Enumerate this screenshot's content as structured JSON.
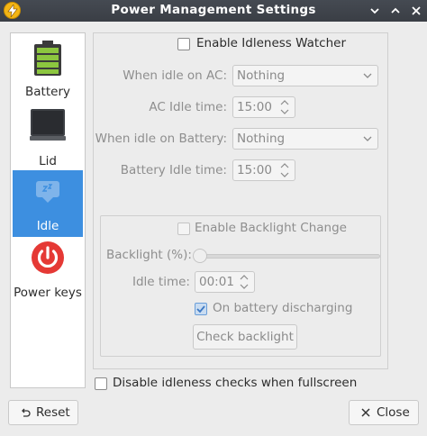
{
  "window": {
    "title": "Power Management Settings"
  },
  "sidebar": {
    "items": [
      {
        "label": "Battery",
        "icon": "battery-icon"
      },
      {
        "label": "Lid",
        "icon": "laptop-lid-icon"
      },
      {
        "label": "Idle",
        "icon": "idle-icon",
        "selected": true
      },
      {
        "label": "Power keys",
        "icon": "power-icon"
      }
    ]
  },
  "idle": {
    "enable_watcher_label": "Enable Idleness Watcher",
    "enable_watcher_checked": false,
    "ac": {
      "when_idle_label": "When idle on AC:",
      "when_idle_value": "Nothing",
      "idle_time_label": "AC Idle time:",
      "idle_time_value": "15:00"
    },
    "battery": {
      "when_idle_label": "When idle on Battery:",
      "when_idle_value": "Nothing",
      "idle_time_label": "Battery Idle time:",
      "idle_time_value": "15:00"
    },
    "backlight": {
      "enable_label": "Enable Backlight Change",
      "enable_checked": false,
      "backlight_label": "Backlight (%):",
      "backlight_level_percent": 0,
      "idle_time_label": "Idle time:",
      "idle_time_value": "00:01",
      "on_battery_label": "On battery discharging",
      "on_battery_checked": true,
      "check_button_label": "Check backlight"
    },
    "disable_fullscreen_label": "Disable idleness checks when fullscreen",
    "disable_fullscreen_checked": false
  },
  "footer": {
    "reset_label": "Reset",
    "close_label": "Close"
  },
  "colors": {
    "accent": "#3d8fe0",
    "titlebar": "#3a3e45",
    "battery_green": "#8cc63f",
    "power_red": "#e53935"
  }
}
